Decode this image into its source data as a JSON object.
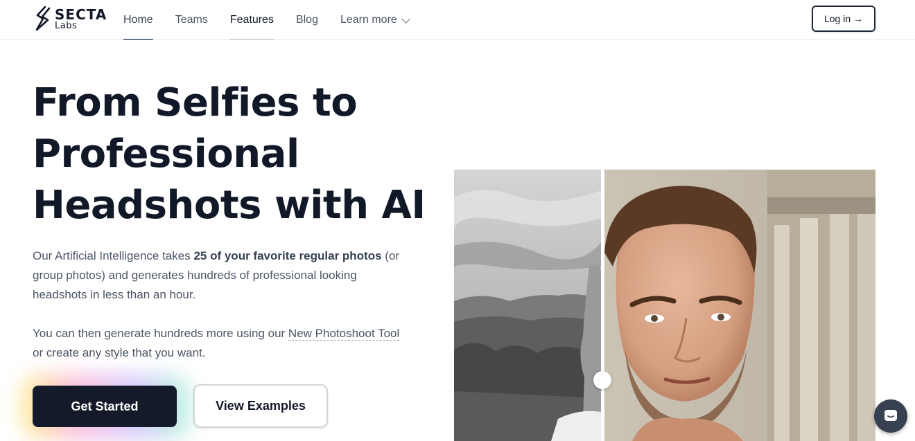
{
  "brand": {
    "name": "SECTA",
    "sub": "Labs"
  },
  "nav": {
    "items": [
      {
        "label": "Home"
      },
      {
        "label": "Teams"
      },
      {
        "label": "Features"
      },
      {
        "label": "Blog"
      },
      {
        "label": "Learn more"
      }
    ],
    "login_label": "Log in →"
  },
  "hero": {
    "title_lines": [
      "From Selfies to",
      "Professional",
      "Headshots with AI"
    ],
    "p1_pre": "Our Artificial Intelligence takes ",
    "p1_bold": "25 of your favorite regular photos",
    "p1_post": " (or group photos) and generates hundreds of professional looking headshots in less than an hour.",
    "p2_pre": "You can then generate hundreds more using our ",
    "p2_link": "New Photoshoot Tool",
    "p2_post": " or create any style that you want.",
    "primary_cta": "Get Started",
    "secondary_cta": "View Examples"
  },
  "compare": {
    "before_alt": "selfie photo",
    "after_alt": "professional headshot"
  },
  "icons": {
    "logo": "secta-logo-icon",
    "chevron": "chevron-down-icon",
    "chat": "chat-bubble-icon"
  },
  "colors": {
    "text_dark": "#111827",
    "text_body": "#4b5563",
    "primary_button": "#141a29",
    "chat_widget": "#374151"
  }
}
